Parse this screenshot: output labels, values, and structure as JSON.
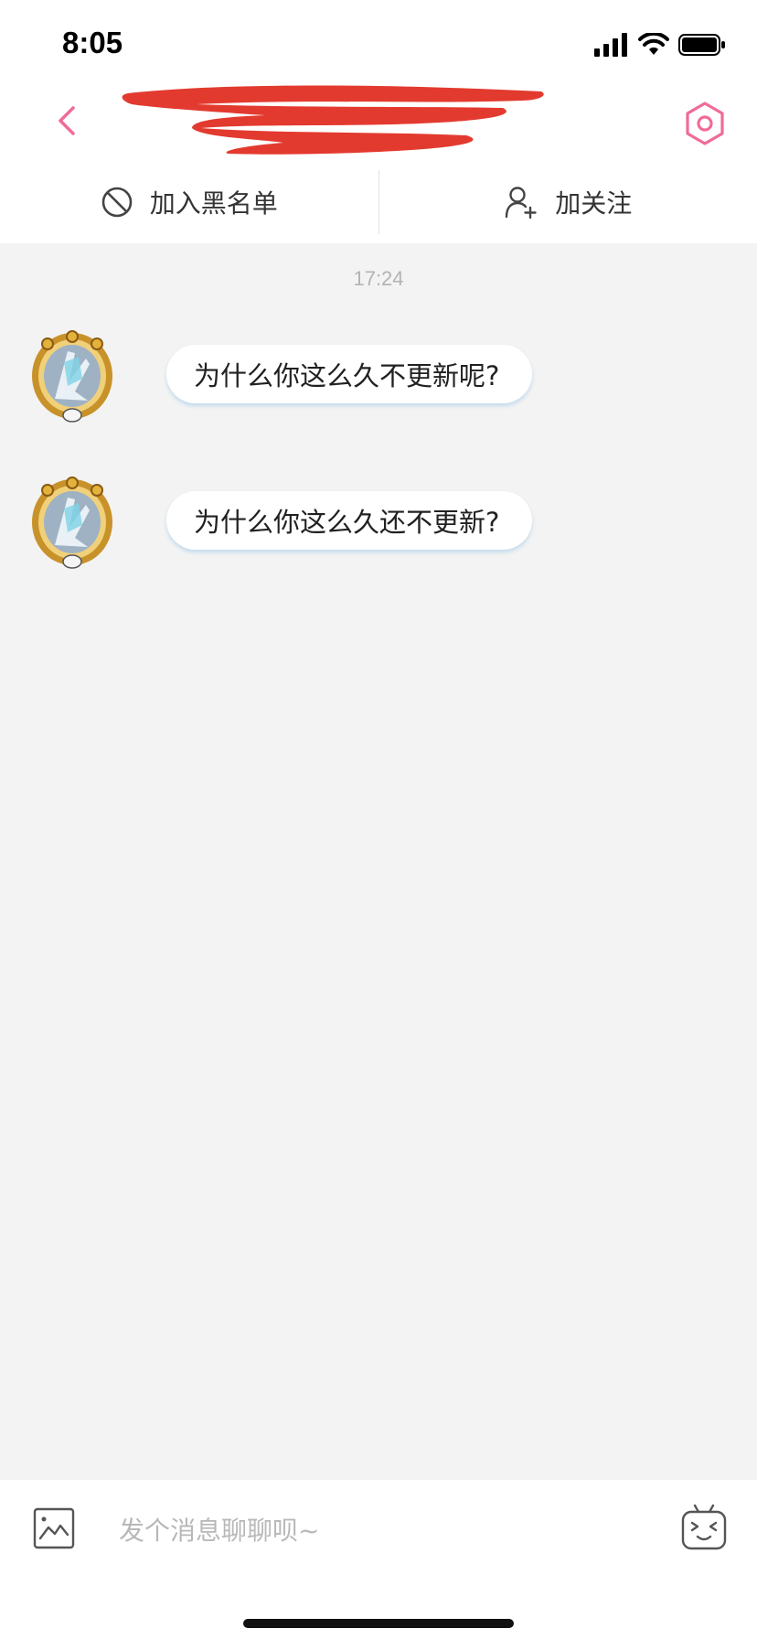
{
  "status_bar": {
    "time": "8:05"
  },
  "nav": {
    "accent_color": "#f06b9a",
    "back_icon": "chevron-left-icon",
    "settings_icon": "hexagon-gear-icon"
  },
  "actions": {
    "blacklist_label": "加入黑名单",
    "follow_label": "加关注"
  },
  "chat": {
    "timestamp": "17:24",
    "messages": [
      {
        "text": "为什么你这么久不更新呢?"
      },
      {
        "text": "为什么你这么久还不更新?"
      }
    ]
  },
  "composer": {
    "placeholder": "发个消息聊聊呗~"
  }
}
